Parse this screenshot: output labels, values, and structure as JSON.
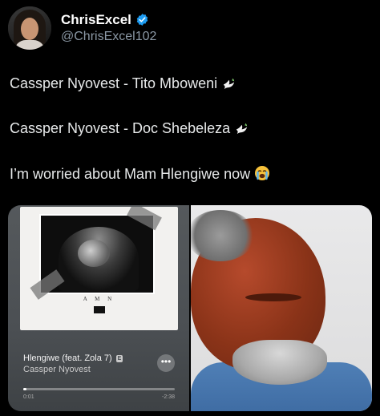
{
  "author": {
    "display_name": "ChrisExcel",
    "handle": "@ChrisExcel102",
    "verified": true,
    "verified_color": "#1d9bf0"
  },
  "tweet": {
    "lines": [
      {
        "text": "Cassper Nyovest - Tito Mboweni",
        "emoji": "dove"
      },
      {
        "text": "Cassper Nyovest - Doc Shebeleza",
        "emoji": "dove"
      },
      {
        "text": "I’m worried about Mam Hlengiwe now",
        "emoji": "loudly-crying-face"
      }
    ]
  },
  "media": {
    "player": {
      "song_title": "Hlengiwe (feat. Zola 7)",
      "explicit_badge": "E",
      "artist": "Cassper Nyovest",
      "more_label": "•••",
      "progress_fraction": 0.01,
      "time_elapsed": "0:01",
      "time_remaining": "-2:38",
      "cover_text": "A M N"
    }
  },
  "colors": {
    "background": "#000000",
    "text": "#e7e9ea",
    "secondary_text": "#8b98a5"
  }
}
